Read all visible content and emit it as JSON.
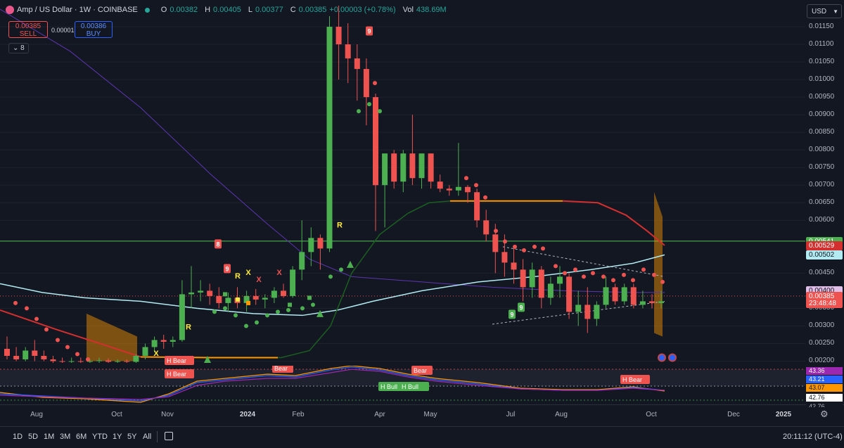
{
  "header": {
    "symbol_title": "Amp / US Dollar · 1W · COINBASE",
    "ohlc": [
      {
        "k": "O",
        "v": "0.00382"
      },
      {
        "k": "H",
        "v": "0.00405"
      },
      {
        "k": "L",
        "v": "0.00377"
      },
      {
        "k": "C",
        "v": "0.00385"
      }
    ],
    "change": "+0.00003 (+0.78%)",
    "vol_label": "Vol",
    "vol_value": "438.69M"
  },
  "trade": {
    "sell_price": "0.00385",
    "sell_label": "SELL",
    "spread": "0.00001",
    "buy_price": "0.00386",
    "buy_label": "BUY",
    "indicators_count": "8"
  },
  "currency": "USD",
  "price_axis": {
    "min": 0.00195,
    "max": 0.0121,
    "ticks": [
      "0.01150",
      "0.01100",
      "0.01050",
      "0.01000",
      "0.00950",
      "0.00900",
      "0.00850",
      "0.00800",
      "0.00750",
      "0.00700",
      "0.00650",
      "0.00600",
      "0.00450",
      "0.00350",
      "0.00300",
      "0.00250",
      "0.00200"
    ],
    "badges": [
      {
        "text": "0.00541",
        "value": 0.00541,
        "bg": "#4caf50",
        "fg": "#ffffff"
      },
      {
        "text": "0.00529",
        "value": 0.00529,
        "bg": "#d32f2f",
        "fg": "#ffffff"
      },
      {
        "text": "0.00502",
        "value": 0.00502,
        "bg": "#b2ebf2",
        "fg": "#131722"
      },
      {
        "text": "0.00400",
        "value": 0.004,
        "bg": "#e1bee7",
        "fg": "#131722"
      },
      {
        "text": "0.00385",
        "value": 0.00385,
        "bg": "#ef5350",
        "fg": "#ffffff"
      },
      {
        "text": "23:48:48",
        "value": 0.00364,
        "bg": "#ef5350",
        "fg": "#ffffff"
      }
    ]
  },
  "indicator_axis": {
    "badges": [
      {
        "text": "43.36",
        "bg": "#9c27b0",
        "fg": "#ffffff"
      },
      {
        "text": "43.21",
        "bg": "#2962ff",
        "fg": "#ffffff"
      },
      {
        "text": "43.07",
        "bg": "#ff9800",
        "fg": "#131722"
      },
      {
        "text": "42.76",
        "bg": "#ffffff",
        "fg": "#131722"
      },
      {
        "text": "42.76",
        "bg": "#131722",
        "fg": "#b2b5be"
      }
    ]
  },
  "time_axis": {
    "labels": [
      {
        "t": "Aug",
        "bold": false
      },
      {
        "t": "Oct",
        "bold": false
      },
      {
        "t": "Nov",
        "bold": false
      },
      {
        "t": "2024",
        "bold": true
      },
      {
        "t": "Feb",
        "bold": false
      },
      {
        "t": "Apr",
        "bold": false
      },
      {
        "t": "May",
        "bold": false
      },
      {
        "t": "Jul",
        "bold": false
      },
      {
        "t": "Aug",
        "bold": false
      },
      {
        "t": "Oct",
        "bold": false
      },
      {
        "t": "Dec",
        "bold": false
      },
      {
        "t": "2025",
        "bold": true
      }
    ]
  },
  "timeframes": [
    "1D",
    "5D",
    "1M",
    "3M",
    "6M",
    "YTD",
    "1Y",
    "5Y",
    "All"
  ],
  "clock": "20:11:12 (UTC-4)",
  "annotations": {
    "h_bear": "H Bear",
    "bear": "Bear",
    "h_bull": "H Bull",
    "r": "R",
    "x": "X",
    "nine": "9",
    "eight": "8"
  },
  "colors": {
    "up": "#4caf50",
    "down": "#ef5350",
    "background": "#131722"
  },
  "chart_data": {
    "type": "candlestick",
    "interval": "1W",
    "candles": [
      {
        "o": 0.00235,
        "h": 0.0027,
        "l": 0.00205,
        "c": 0.00215
      },
      {
        "o": 0.00215,
        "h": 0.0024,
        "l": 0.002,
        "c": 0.00205
      },
      {
        "o": 0.00205,
        "h": 0.0024,
        "l": 0.002,
        "c": 0.0023
      },
      {
        "o": 0.0023,
        "h": 0.0026,
        "l": 0.002,
        "c": 0.00215
      },
      {
        "o": 0.00215,
        "h": 0.0023,
        "l": 0.002,
        "c": 0.00205
      },
      {
        "o": 0.00205,
        "h": 0.00215,
        "l": 0.00195,
        "c": 0.002
      },
      {
        "o": 0.002,
        "h": 0.0021,
        "l": 0.00195,
        "c": 0.00198
      },
      {
        "o": 0.00198,
        "h": 0.0021,
        "l": 0.00195,
        "c": 0.002
      },
      {
        "o": 0.002,
        "h": 0.0021,
        "l": 0.00195,
        "c": 0.00198
      },
      {
        "o": 0.00198,
        "h": 0.00205,
        "l": 0.00195,
        "c": 0.002
      },
      {
        "o": 0.002,
        "h": 0.0021,
        "l": 0.00195,
        "c": 0.00202
      },
      {
        "o": 0.00202,
        "h": 0.00208,
        "l": 0.00195,
        "c": 0.00198
      },
      {
        "o": 0.00198,
        "h": 0.00205,
        "l": 0.00195,
        "c": 0.002
      },
      {
        "o": 0.002,
        "h": 0.00205,
        "l": 0.00195,
        "c": 0.00198
      },
      {
        "o": 0.00198,
        "h": 0.0022,
        "l": 0.00195,
        "c": 0.00215
      },
      {
        "o": 0.00215,
        "h": 0.0025,
        "l": 0.00205,
        "c": 0.0024
      },
      {
        "o": 0.0024,
        "h": 0.0027,
        "l": 0.00225,
        "c": 0.0026
      },
      {
        "o": 0.0026,
        "h": 0.00275,
        "l": 0.00235,
        "c": 0.00255
      },
      {
        "o": 0.00255,
        "h": 0.0027,
        "l": 0.0024,
        "c": 0.0026
      },
      {
        "o": 0.0026,
        "h": 0.0043,
        "l": 0.00255,
        "c": 0.0039
      },
      {
        "o": 0.0039,
        "h": 0.0047,
        "l": 0.0035,
        "c": 0.00395
      },
      {
        "o": 0.00395,
        "h": 0.0043,
        "l": 0.0037,
        "c": 0.004
      },
      {
        "o": 0.004,
        "h": 0.0042,
        "l": 0.0036,
        "c": 0.00385
      },
      {
        "o": 0.00385,
        "h": 0.0041,
        "l": 0.0035,
        "c": 0.00365
      },
      {
        "o": 0.00365,
        "h": 0.00395,
        "l": 0.0034,
        "c": 0.0038
      },
      {
        "o": 0.0038,
        "h": 0.0041,
        "l": 0.0035,
        "c": 0.00365
      },
      {
        "o": 0.00365,
        "h": 0.004,
        "l": 0.0034,
        "c": 0.00385
      },
      {
        "o": 0.00385,
        "h": 0.00405,
        "l": 0.0036,
        "c": 0.00375
      },
      {
        "o": 0.00375,
        "h": 0.0039,
        "l": 0.0035,
        "c": 0.0038
      },
      {
        "o": 0.0038,
        "h": 0.0041,
        "l": 0.00365,
        "c": 0.004
      },
      {
        "o": 0.004,
        "h": 0.0042,
        "l": 0.0038,
        "c": 0.00385
      },
      {
        "o": 0.00385,
        "h": 0.0047,
        "l": 0.0038,
        "c": 0.0046
      },
      {
        "o": 0.0046,
        "h": 0.006,
        "l": 0.0043,
        "c": 0.0051
      },
      {
        "o": 0.0051,
        "h": 0.0058,
        "l": 0.0047,
        "c": 0.0055
      },
      {
        "o": 0.0055,
        "h": 0.0056,
        "l": 0.0046,
        "c": 0.0052
      },
      {
        "o": 0.0052,
        "h": 0.0118,
        "l": 0.0051,
        "c": 0.0115
      },
      {
        "o": 0.0115,
        "h": 0.0121,
        "l": 0.01,
        "c": 0.011
      },
      {
        "o": 0.011,
        "h": 0.0116,
        "l": 0.0099,
        "c": 0.0106
      },
      {
        "o": 0.0106,
        "h": 0.011,
        "l": 0.0094,
        "c": 0.0103
      },
      {
        "o": 0.0103,
        "h": 0.0106,
        "l": 0.0087,
        "c": 0.0095
      },
      {
        "o": 0.0095,
        "h": 0.0096,
        "l": 0.0057,
        "c": 0.007
      },
      {
        "o": 0.007,
        "h": 0.0079,
        "l": 0.0058,
        "c": 0.0079
      },
      {
        "o": 0.0079,
        "h": 0.008,
        "l": 0.0069,
        "c": 0.0071
      },
      {
        "o": 0.0071,
        "h": 0.008,
        "l": 0.0068,
        "c": 0.0079
      },
      {
        "o": 0.0079,
        "h": 0.009,
        "l": 0.007,
        "c": 0.0072
      },
      {
        "o": 0.0072,
        "h": 0.0079,
        "l": 0.0069,
        "c": 0.0079
      },
      {
        "o": 0.0079,
        "h": 0.0079,
        "l": 0.0069,
        "c": 0.0071
      },
      {
        "o": 0.0071,
        "h": 0.0073,
        "l": 0.0068,
        "c": 0.0069
      },
      {
        "o": 0.0069,
        "h": 0.007,
        "l": 0.0067,
        "c": 0.00685
      },
      {
        "o": 0.00685,
        "h": 0.0082,
        "l": 0.0067,
        "c": 0.00695
      },
      {
        "o": 0.00695,
        "h": 0.007,
        "l": 0.0065,
        "c": 0.0068
      },
      {
        "o": 0.0068,
        "h": 0.0069,
        "l": 0.0058,
        "c": 0.006
      },
      {
        "o": 0.006,
        "h": 0.0063,
        "l": 0.0054,
        "c": 0.0056
      },
      {
        "o": 0.0056,
        "h": 0.0059,
        "l": 0.0045,
        "c": 0.0051
      },
      {
        "o": 0.0051,
        "h": 0.0056,
        "l": 0.0044,
        "c": 0.0048
      },
      {
        "o": 0.0048,
        "h": 0.0052,
        "l": 0.0042,
        "c": 0.0046
      },
      {
        "o": 0.0046,
        "h": 0.0049,
        "l": 0.0037,
        "c": 0.0041
      },
      {
        "o": 0.0041,
        "h": 0.0048,
        "l": 0.0038,
        "c": 0.0046
      },
      {
        "o": 0.0046,
        "h": 0.0047,
        "l": 0.0035,
        "c": 0.0038
      },
      {
        "o": 0.0038,
        "h": 0.0044,
        "l": 0.0036,
        "c": 0.0042
      },
      {
        "o": 0.0042,
        "h": 0.0047,
        "l": 0.0038,
        "c": 0.0044
      },
      {
        "o": 0.0044,
        "h": 0.0045,
        "l": 0.0032,
        "c": 0.0034
      },
      {
        "o": 0.0034,
        "h": 0.004,
        "l": 0.003,
        "c": 0.0036
      },
      {
        "o": 0.0036,
        "h": 0.0041,
        "l": 0.0028,
        "c": 0.0032
      },
      {
        "o": 0.0032,
        "h": 0.0037,
        "l": 0.003,
        "c": 0.0036
      },
      {
        "o": 0.0036,
        "h": 0.0044,
        "l": 0.0035,
        "c": 0.0041
      },
      {
        "o": 0.0041,
        "h": 0.0042,
        "l": 0.0036,
        "c": 0.0037
      },
      {
        "o": 0.0037,
        "h": 0.0042,
        "l": 0.0036,
        "c": 0.0041
      },
      {
        "o": 0.0041,
        "h": 0.0042,
        "l": 0.0035,
        "c": 0.0036
      },
      {
        "o": 0.0036,
        "h": 0.004,
        "l": 0.0035,
        "c": 0.0037
      },
      {
        "o": 0.0037,
        "h": 0.0039,
        "l": 0.0035,
        "c": 0.00365
      },
      {
        "o": 0.00365,
        "h": 0.004,
        "l": 0.0035,
        "c": 0.0037
      },
      {
        "o": 0.0037,
        "h": 0.0042,
        "l": 0.0036,
        "c": 0.0041
      },
      {
        "o": 0.0041,
        "h": 0.0042,
        "l": 0.0037,
        "c": 0.0038
      },
      {
        "o": 0.0038,
        "h": 0.0043,
        "l": 0.0037,
        "c": 0.0042
      },
      {
        "o": 0.0042,
        "h": 0.0044,
        "l": 0.0036,
        "c": 0.00375
      },
      {
        "o": 0.00375,
        "h": 0.0041,
        "l": 0.0037,
        "c": 0.00382
      },
      {
        "o": 0.00382,
        "h": 0.00405,
        "l": 0.00377,
        "c": 0.00385
      }
    ]
  }
}
